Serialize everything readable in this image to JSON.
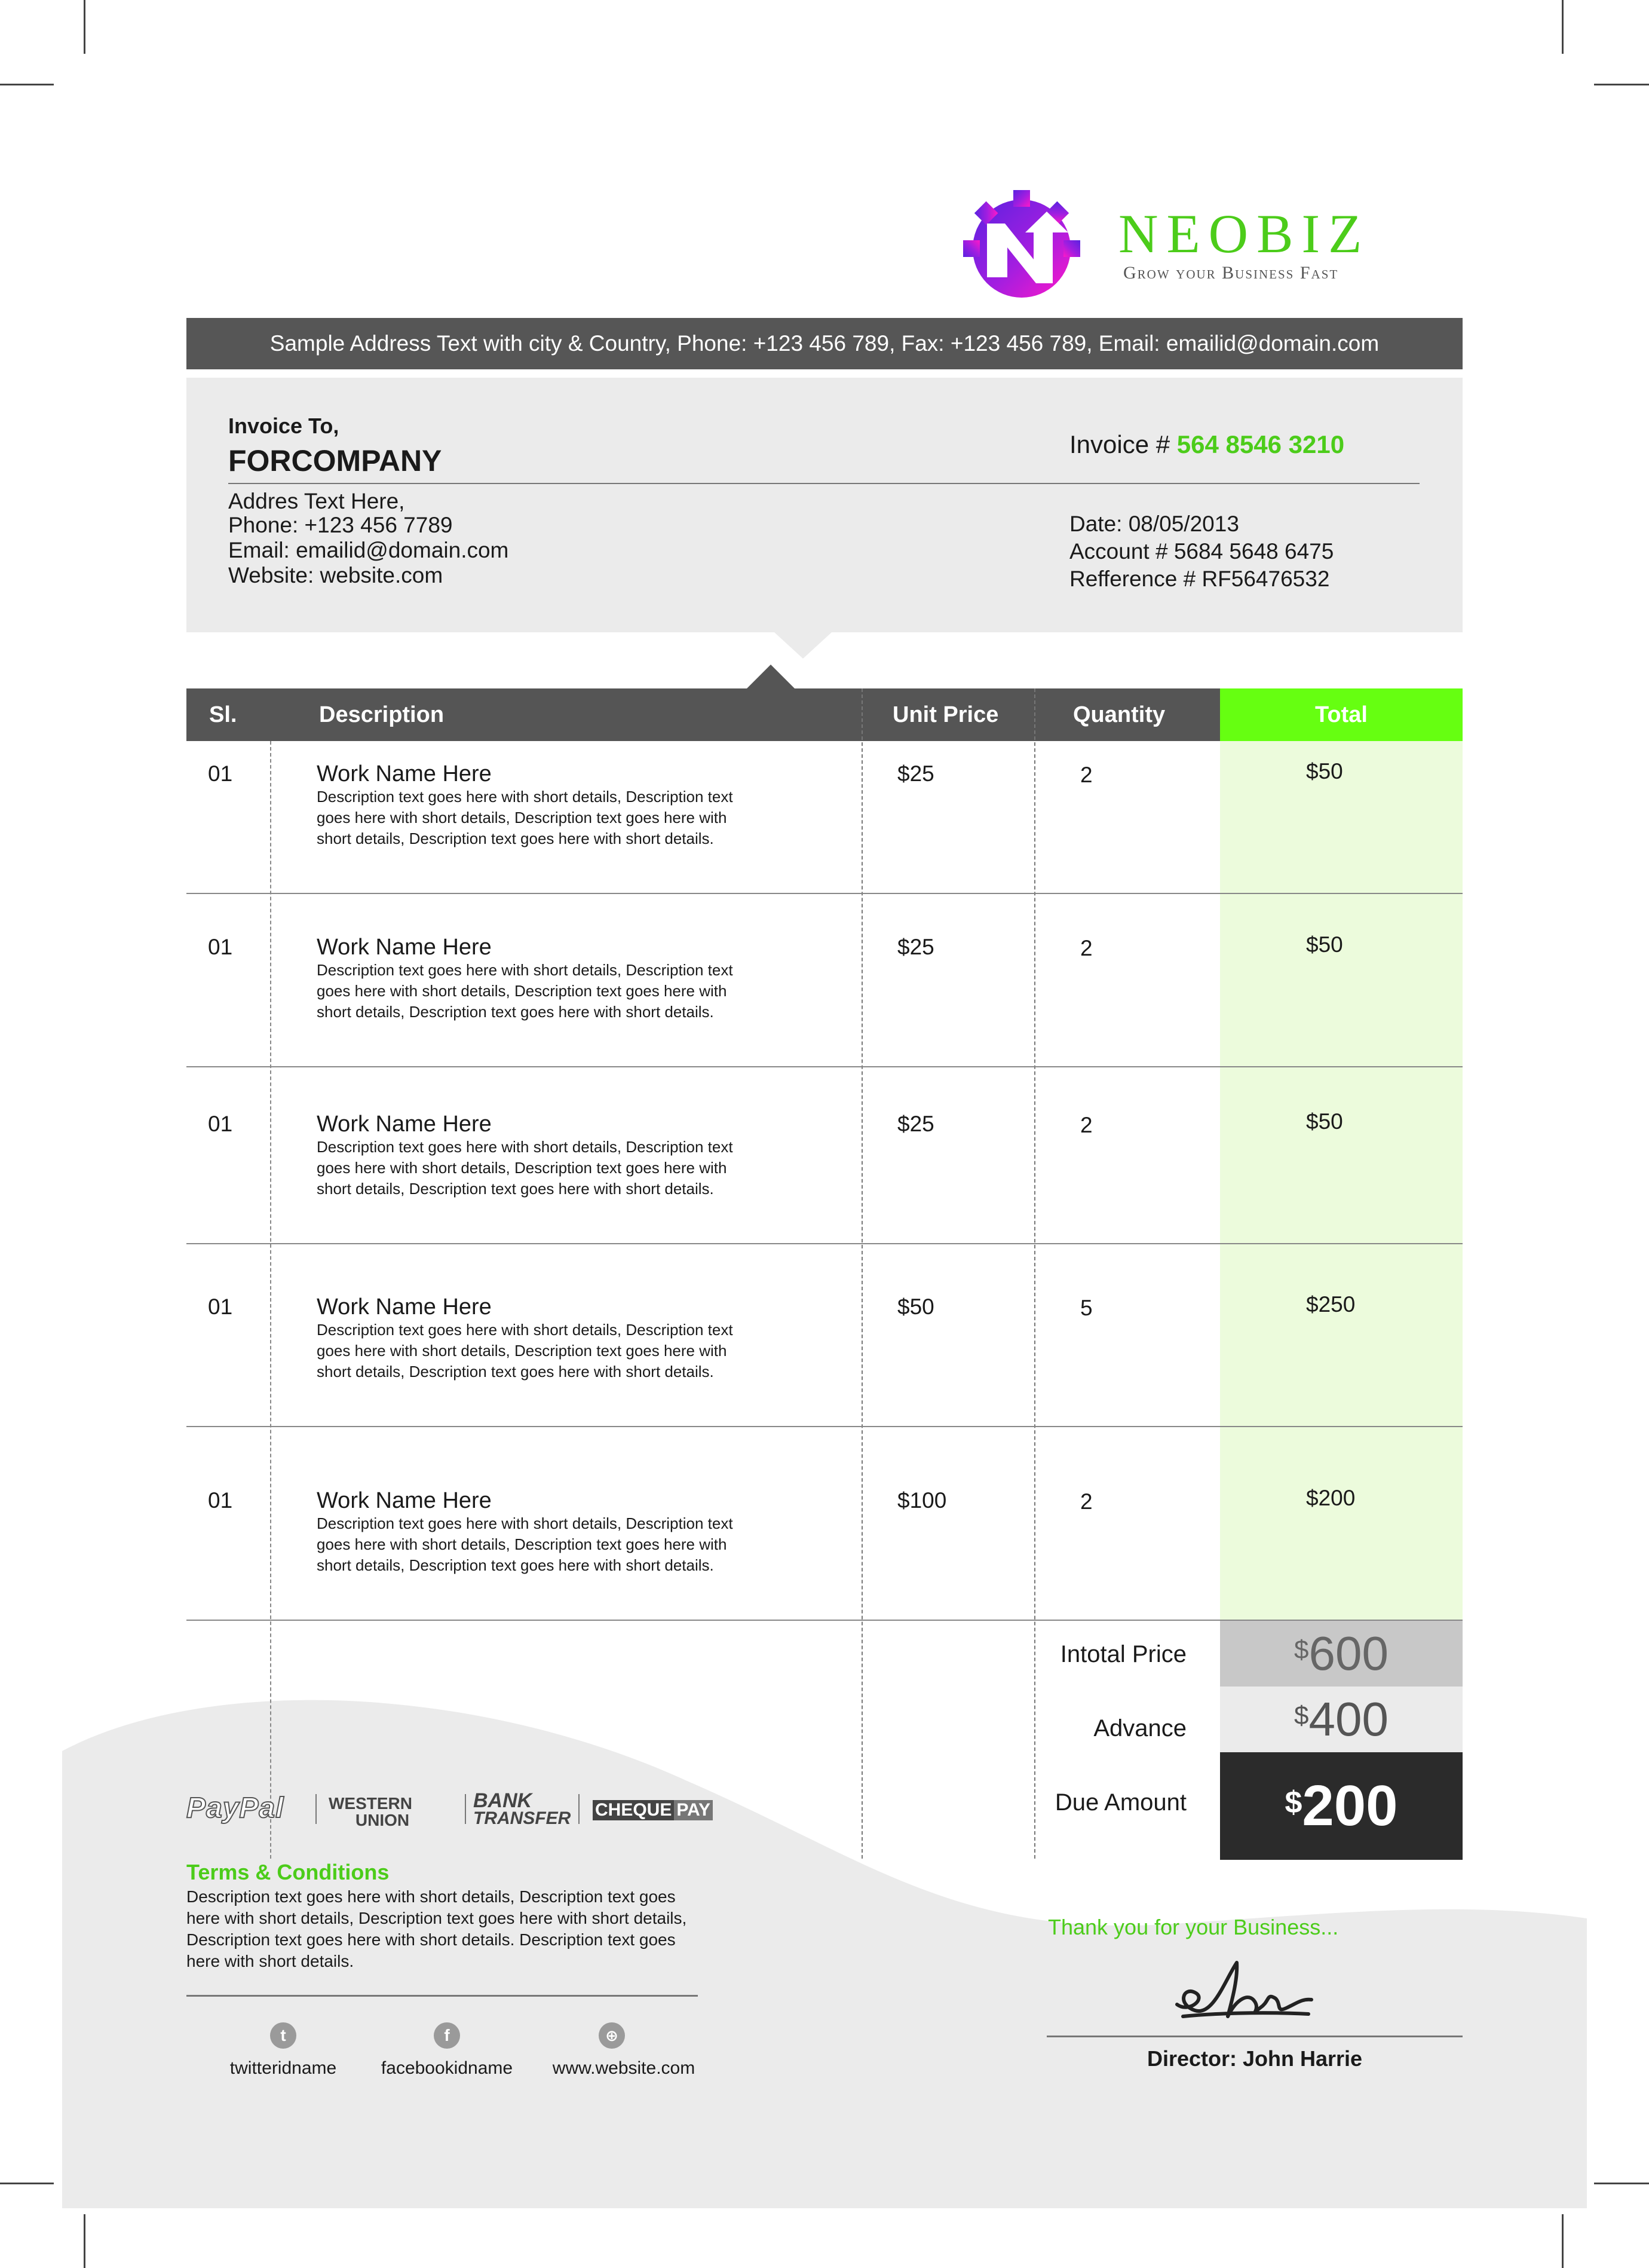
{
  "brand": {
    "name": "NEOBIZ",
    "tagline": "Grow your Business Fast",
    "colors": {
      "accent": "#55ff11",
      "accent_text": "#4ccc1a",
      "logo_purple": "#6a1fd8",
      "logo_magenta": "#f21ad6",
      "bar": "#565656"
    }
  },
  "address_bar": "Sample Address Text with city & Country, Phone: +123 456 789, Fax: +123 456 789, Email: emailid@domain.com",
  "invoice_to": {
    "heading": "Invoice To,",
    "company": "FORCOMPANY",
    "address": "Addres Text Here,",
    "phone": "Phone: +123 456 7789",
    "email": "Email: emailid@domain.com",
    "website": "Website: website.com"
  },
  "invoice": {
    "number_label": "Invoice #",
    "number": "564 8546 3210",
    "date": "Date: 08/05/2013",
    "account": "Account # 5684 5648 6475",
    "reference": "Refference # RF56476532"
  },
  "table": {
    "headers": {
      "sl": "Sl.",
      "description": "Description",
      "unit_price": "Unit Price",
      "quantity": "Quantity",
      "total": "Total"
    },
    "rows": [
      {
        "sl": "01",
        "name": "Work Name Here",
        "desc1": "Description text goes here with short details, Description text",
        "desc2": "goes here with short details, Description text goes here with",
        "desc3": "short details, Description text goes here with short details.",
        "unit_price": "$25",
        "quantity": "2",
        "total": "$50"
      },
      {
        "sl": "01",
        "name": "Work Name Here",
        "desc1": "Description text goes here with short details, Description text",
        "desc2": "goes here with short details, Description text goes here with",
        "desc3": "short details, Description text goes here with short details.",
        "unit_price": "$25",
        "quantity": "2",
        "total": "$50"
      },
      {
        "sl": "01",
        "name": "Work Name Here",
        "desc1": "Description text goes here with short details, Description text",
        "desc2": "goes here with short details, Description text goes here with",
        "desc3": "short details, Description text goes here with short details.",
        "unit_price": "$25",
        "quantity": "2",
        "total": "$50"
      },
      {
        "sl": "01",
        "name": "Work Name Here",
        "desc1": "Description text goes here with short details, Description text",
        "desc2": "goes here with short details, Description text goes here with",
        "desc3": "short details, Description text goes here with short details.",
        "unit_price": "$50",
        "quantity": "5",
        "total": "$250"
      },
      {
        "sl": "01",
        "name": "Work Name Here",
        "desc1": "Description text goes here with short details, Description text",
        "desc2": "goes here with short details, Description text goes here with",
        "desc3": "short details, Description text goes here with short details.",
        "unit_price": "$100",
        "quantity": "2",
        "total": "$200"
      }
    ]
  },
  "summary": {
    "intotal_label": "Intotal Price",
    "intotal_currency": "$",
    "intotal_value": "600",
    "advance_label": "Advance",
    "advance_currency": "$",
    "advance_value": "400",
    "due_label": "Due Amount",
    "due_currency": "$",
    "due_value": "200"
  },
  "payment_methods": {
    "paypal": "PayPal",
    "western_union_1": "WESTERN",
    "western_union_2": "UNION",
    "bank_1": "BANK",
    "bank_2": "TRANSFER",
    "cheque_1": "CHEQUE",
    "cheque_2": "PAY"
  },
  "terms": {
    "title": "Terms & Conditions",
    "line1": "Description text goes here with short details, Description text goes",
    "line2": "here with short details, Description text goes here with short details,",
    "line3": "Description text goes here with short details. Description text goes",
    "line4": "here with short details."
  },
  "social": {
    "twitter": "twitteridname",
    "facebook": "facebookidname",
    "website": "www.website.com"
  },
  "closing": {
    "thanks": "Thank you for your Business...",
    "signatory": "Director: John Harrie"
  }
}
